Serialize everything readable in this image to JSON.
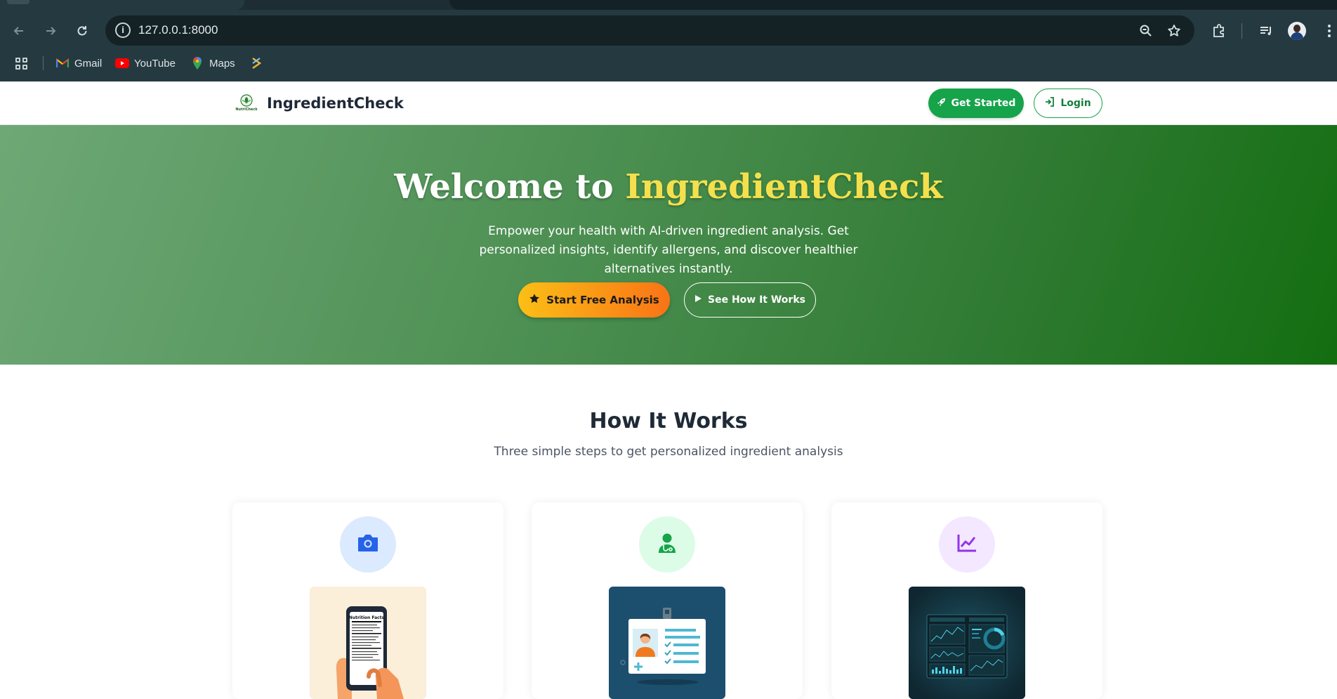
{
  "browser": {
    "url": "127.0.0.1:8000",
    "bookmarks": [
      {
        "label": "Gmail",
        "icon": "gmail-icon"
      },
      {
        "label": "YouTube",
        "icon": "youtube-icon"
      },
      {
        "label": "Maps",
        "icon": "maps-pin-icon"
      },
      {
        "label": "",
        "icon": "bookmark-logo-icon"
      }
    ]
  },
  "navbar": {
    "brand": "IngredientCheck",
    "logo_text": "NutriCheck",
    "get_started_label": "Get Started",
    "login_label": "Login"
  },
  "hero": {
    "title_prefix": "Welcome to ",
    "title_highlight": "IngredientCheck",
    "subtitle": "Empower your health with AI-driven ingredient analysis. Get personalized insights, identify allergens, and discover healthier alternatives instantly.",
    "primary_cta": "Start Free Analysis",
    "secondary_cta": "See How It Works"
  },
  "how_it_works": {
    "title": "How It Works",
    "subtitle": "Three simple steps to get personalized ingredient analysis",
    "steps": [
      {
        "icon": "camera-icon",
        "circle_color": "#dbeafe",
        "icon_color": "#2563eb",
        "illustration": "phone-nutrition-label"
      },
      {
        "icon": "doctor-user-icon",
        "circle_color": "#dcfce7",
        "icon_color": "#16a34a",
        "illustration": "health-profile-card"
      },
      {
        "icon": "chart-line-icon",
        "circle_color": "#f3e8ff",
        "icon_color": "#9333ea",
        "illustration": "analytics-dashboard"
      }
    ]
  },
  "colors": {
    "accent_green": "#16a34a",
    "hero_highlight": "#f4e04d",
    "cta_gradient_start": "#fbbf16",
    "cta_gradient_end": "#f97316"
  }
}
